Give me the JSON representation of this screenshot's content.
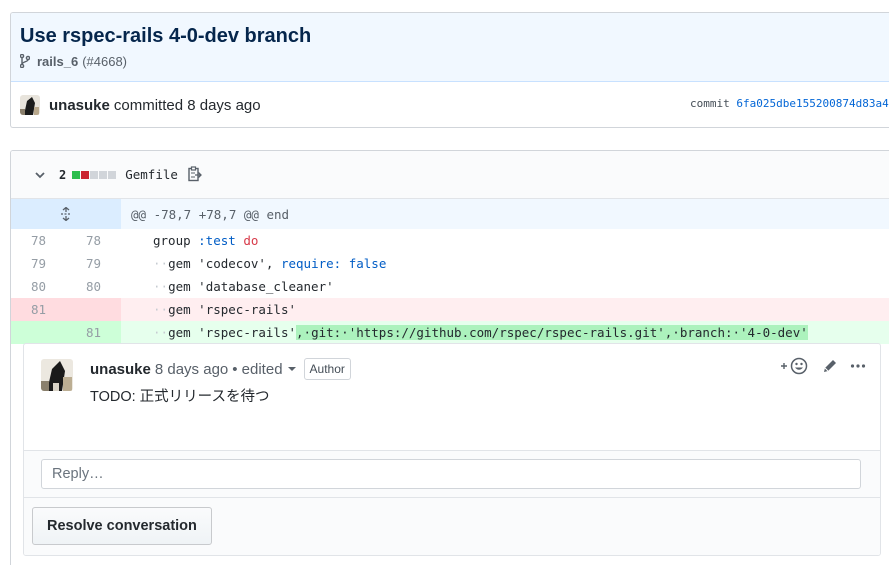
{
  "commit": {
    "title": "Use rspec-rails 4-0-dev branch",
    "branch": "rails_6",
    "pr_ref": "(#4668)",
    "author": "unasuke",
    "committed_text": "committed 8 days ago",
    "sha_label": "commit",
    "sha": "6fa025dbe155200874d83a4"
  },
  "file": {
    "change_count": "2",
    "diffstat": [
      "#2cbe4e",
      "#cb2431",
      "#d1d5da",
      "#d1d5da",
      "#d1d5da"
    ],
    "filename": "Gemfile",
    "hunk_header": "@@ -78,7 +78,7 @@ end"
  },
  "diff_lines": [
    {
      "old": "78",
      "new": "78",
      "type": "context"
    },
    {
      "old": "79",
      "new": "79",
      "type": "context"
    },
    {
      "old": "80",
      "new": "80",
      "type": "context"
    },
    {
      "old": "81",
      "new": "",
      "type": "deletion"
    },
    {
      "old": "",
      "new": "81",
      "type": "addition"
    }
  ],
  "code": {
    "l1_a": "group ",
    "l1_b": ":test",
    "l1_c": " ",
    "l1_d": "do",
    "l2_ws": "··",
    "l2_a": "gem ",
    "l2_b": "'codecov'",
    "l2_c": ", ",
    "l2_d": "require:",
    "l2_e": " ",
    "l2_f": "false",
    "l3_ws": "··",
    "l3_a": "gem ",
    "l3_b": "'database_cleaner'",
    "l4_ws": "··",
    "l4_a": "gem ",
    "l4_b": "'rspec-rails'",
    "l5_ws": "··",
    "l5_a": "gem ",
    "l5_b": "'rspec-rails'",
    "l5_hl": ",·git:·'https://github.com/rspec/rspec-rails.git',·branch:·'4-0-dev'"
  },
  "comment": {
    "author": "unasuke",
    "time": "8 days ago",
    "edited": "• edited",
    "badge": "Author",
    "body": "TODO: 正式リリースを待つ"
  },
  "reply": {
    "placeholder": "Reply…"
  },
  "resolve_button": "Resolve conversation",
  "icons": {
    "branch": "git-branch-icon",
    "chevron": "chevron-down-icon",
    "copy": "clipboard-icon",
    "expand": "unfold-icon",
    "reaction": "add-reaction-icon",
    "edit": "pencil-icon",
    "more": "kebab-horizontal-icon"
  }
}
